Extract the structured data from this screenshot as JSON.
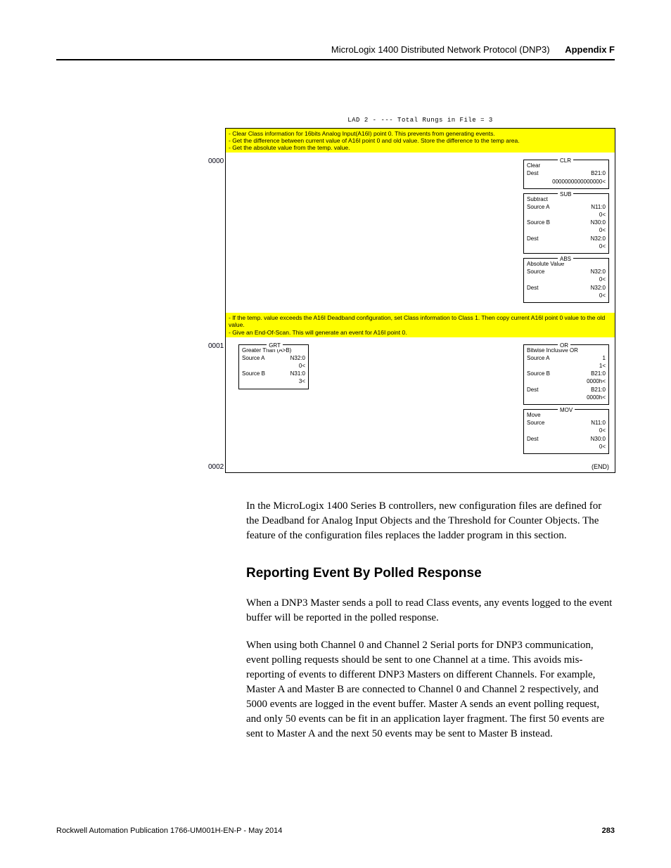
{
  "header": {
    "doc_title": "MicroLogix 1400 Distributed Network Protocol (DNP3)",
    "appendix": "Appendix F"
  },
  "figure": {
    "title_line": "LAD 2 -   --- Total Rungs in File = 3",
    "rungs": [
      {
        "label": "0000",
        "comment_lines": [
          "- Clear Class information for 16bits Analog Input(A16I) point 0. This prevents from generating events.",
          "- Get the difference between current value of A16I point 0 and old value. Store the difference to the temp area.",
          "- Get the absolute value from the temp. value."
        ],
        "blocks": [
          {
            "title": "CLR",
            "lines": [
              [
                "Clear",
                ""
              ],
              [
                "Dest",
                "B21:0"
              ],
              [
                "",
                "0000000000000000<"
              ]
            ]
          },
          {
            "title": "SUB",
            "lines": [
              [
                "Subtract",
                ""
              ],
              [
                "Source A",
                "N11:0"
              ],
              [
                "",
                "0<"
              ],
              [
                "Source B",
                "N30:0"
              ],
              [
                "",
                "0<"
              ],
              [
                "Dest",
                "N32:0"
              ],
              [
                "",
                "0<"
              ]
            ]
          },
          {
            "title": "ABS",
            "lines": [
              [
                "Absolute Value",
                ""
              ],
              [
                "Source",
                "N32:0"
              ],
              [
                "",
                "0<"
              ],
              [
                "Dest",
                "N32:0"
              ],
              [
                "",
                "0<"
              ]
            ]
          }
        ]
      },
      {
        "label": "0001",
        "comment_lines": [
          "- If the temp. value exceeds the A16I Deadband configuration, set Class information to Class 1. Then copy current A16I point 0 value to the old value.",
          "- Give an End-Of-Scan. This will generate an event for A16I point 0."
        ],
        "left_block": {
          "title": "GRT",
          "lines": [
            [
              "Greater Than (A>B)",
              ""
            ],
            [
              "Source A",
              "N32:0"
            ],
            [
              "",
              "0<"
            ],
            [
              "Source B",
              "N31:0"
            ],
            [
              "",
              "3<"
            ]
          ]
        },
        "blocks": [
          {
            "title": "OR",
            "lines": [
              [
                "Bitwise Inclusive OR",
                ""
              ],
              [
                "Source A",
                "1"
              ],
              [
                "",
                "1<"
              ],
              [
                "Source B",
                "B21:0"
              ],
              [
                "",
                "0000h<"
              ],
              [
                "Dest",
                "B21:0"
              ],
              [
                "",
                "0000h<"
              ]
            ]
          },
          {
            "title": "MOV",
            "lines": [
              [
                "Move",
                ""
              ],
              [
                "Source",
                "N11:0"
              ],
              [
                "",
                "0<"
              ],
              [
                "Dest",
                "N30:0"
              ],
              [
                "",
                "0<"
              ]
            ]
          }
        ]
      },
      {
        "label": "0002",
        "end": "(END)"
      }
    ]
  },
  "body": {
    "para1": "In the MicroLogix 1400 Series B controllers, new configuration files are defined for the Deadband for Analog Input Objects and the Threshold for Counter Objects. The feature of the configuration files replaces the ladder program in this section.",
    "heading": "Reporting Event By Polled Response",
    "para2": "When a DNP3 Master sends a poll to read Class events, any events  logged to the event buffer will be reported in the polled response.",
    "para3": "When using both Channel 0 and Channel 2 Serial ports for DNP3 communication, event polling requests should be sent to one Channel at a time. This avoids mis-reporting of events to different DNP3 Masters on different Channels. For example, Master A and Master B are connected to Channel 0 and Channel 2 respectively, and 5000 events are logged in the event buffer. Master A sends an event polling request, and only 50 events can be fit in an application layer fragment. The first 50 events are sent to Master A and the next 50 events may be sent to Master B instead."
  },
  "footer": {
    "pub": "Rockwell Automation Publication 1766-UM001H-EN-P - May 2014",
    "page": "283"
  }
}
